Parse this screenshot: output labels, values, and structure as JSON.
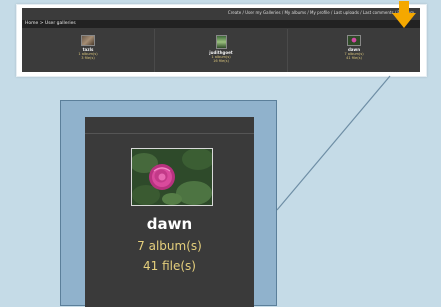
{
  "header": {
    "top_links": "Create / User my Galleries / My albums / My profile / Last uploads / Last comments / Random"
  },
  "breadcrumb": "Home > User galleries",
  "galleries": [
    {
      "name": "tazls",
      "albums": "1 album(s)",
      "files": "3 file(s)"
    },
    {
      "name": "judithgoet",
      "albums": "1 album(s)",
      "files": "16 file(s)"
    },
    {
      "name": "dawn",
      "albums": "7 album(s)",
      "files": "41 file(s)"
    }
  ],
  "zoom": {
    "name": "dawn",
    "albums": "7 album(s)",
    "files": "41 file(s)"
  },
  "colors": {
    "page_background": "#c5dbe7",
    "panel_dark": "#3a3a3a",
    "accent_gold": "#e5cf7c",
    "arrow_orange": "#f5a800",
    "zoom_frame": "#90b2cc"
  },
  "icons": {
    "highlight_arrow": "down-arrow-icon"
  }
}
